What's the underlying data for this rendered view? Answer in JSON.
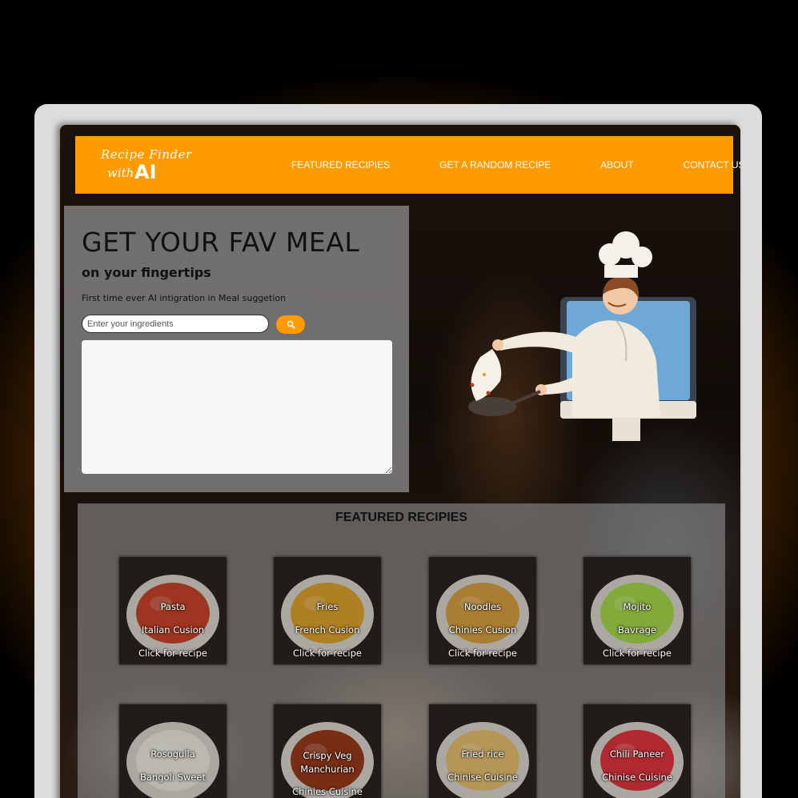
{
  "logo": {
    "line1": "Recipe Finder",
    "line2_small": "with",
    "line2_big": "AI"
  },
  "nav": {
    "links": [
      "FEATURED RECIPIES",
      "GET A RANDOM RECIPE",
      "ABOUT",
      "CONTACT US"
    ]
  },
  "hero": {
    "title": "GET YOUR FAV MEAL",
    "subtitle": "on your fingertips",
    "description": "First time ever AI intigration in Meal suggetion",
    "input_placeholder": "Enter your ingredients",
    "input_value": "",
    "search_icon": "search-icon"
  },
  "featured": {
    "title": "FEATURED RECIPIES",
    "cards": [
      {
        "name": "Pasta",
        "cuisine": "Italian Cusion",
        "cta": "Click for recipe",
        "photo_color": "#c9452a"
      },
      {
        "name": "Fries",
        "cuisine": "French Cusion",
        "cta": "Click for recipe",
        "photo_color": "#e0a32e"
      },
      {
        "name": "Noodles",
        "cuisine": "Chinies Cusion",
        "cta": "Click for recipe",
        "photo_color": "#d9a040"
      },
      {
        "name": "Mojito",
        "cuisine": "Bavrage",
        "cta": "Click for recipe",
        "photo_color": "#a7d94a"
      },
      {
        "name": "Rosogulla",
        "cuisine": "Bangoli Sweet",
        "cta": "",
        "photo_color": "#f0eee0"
      },
      {
        "name": "Crispy Veg Manchurian",
        "cuisine": "Chinies Cuisine",
        "cta": "",
        "photo_color": "#9a3a1c"
      },
      {
        "name": "Fried rice",
        "cuisine": "Chinise Cuisine",
        "cta": "",
        "photo_color": "#e8c070"
      },
      {
        "name": "Chili Paneer",
        "cuisine": "Chinise Cuisine",
        "cta": "",
        "photo_color": "#e2353e"
      }
    ]
  },
  "colors": {
    "accent": "#ff9a00",
    "panel": "#969696",
    "frame": "#dcdcdc"
  }
}
